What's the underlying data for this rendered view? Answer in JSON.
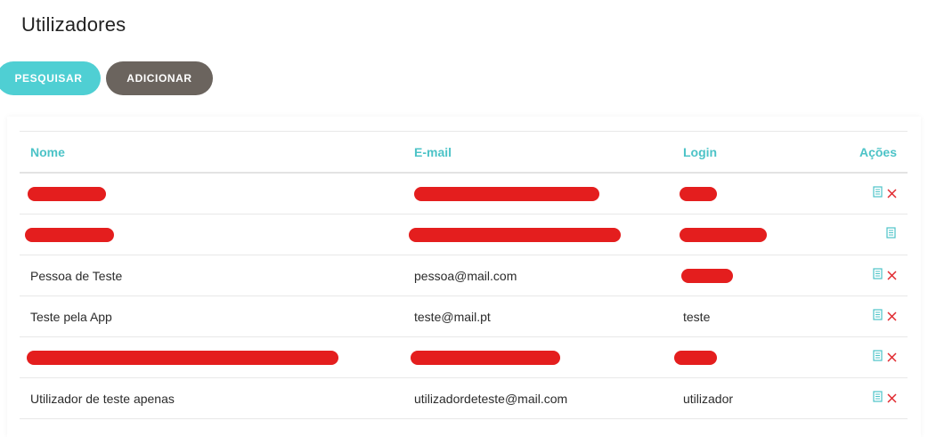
{
  "page": {
    "title": "Utilizadores"
  },
  "toolbar": {
    "search_label": "PESQUISAR",
    "add_label": "ADICIONAR"
  },
  "table": {
    "headers": {
      "name": "Nome",
      "email": "E-mail",
      "login": "Login",
      "actions": "Ações"
    },
    "rows": [
      {
        "name": "",
        "email": "",
        "login": "",
        "redacted": true,
        "deletable": true
      },
      {
        "name": "",
        "email": "",
        "login": "",
        "redacted": true,
        "deletable": false
      },
      {
        "name": "Pessoa de Teste",
        "email": "pessoa@mail.com",
        "login": "",
        "redacted_login": true,
        "deletable": true
      },
      {
        "name": "Teste pela App",
        "email": "teste@mail.pt",
        "login": "teste",
        "deletable": true
      },
      {
        "name": "",
        "email": "",
        "login": "",
        "redacted": true,
        "deletable": true
      },
      {
        "name": "Utilizador de teste apenas",
        "email": "utilizadordeteste@mail.com",
        "login": "utilizador",
        "deletable": true
      }
    ]
  },
  "icons": {
    "edit": "document-icon",
    "delete": "close-icon"
  },
  "colors": {
    "accent": "#4cc3c7",
    "search_button": "#4fcfd3",
    "add_button": "#6b645e",
    "delete": "#e0282e",
    "redaction": "#e41e1e"
  }
}
